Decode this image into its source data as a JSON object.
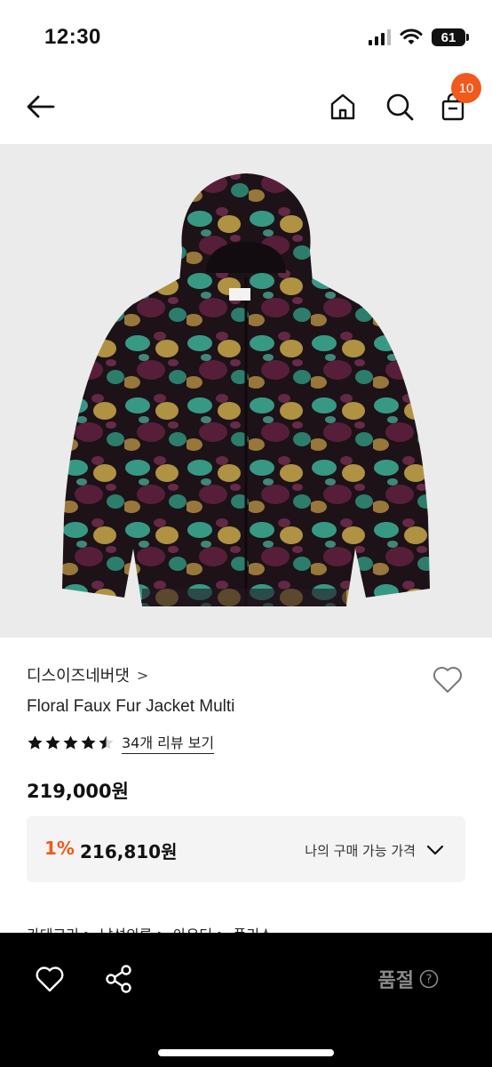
{
  "status_bar": {
    "time": "12:30",
    "battery": "61",
    "icons": [
      "cellular-signal-icon",
      "wifi-icon",
      "battery-icon"
    ]
  },
  "nav": {
    "icons": [
      "arrow-left-icon",
      "home-icon",
      "search-icon",
      "shopping-bag-icon"
    ],
    "cart_count": "10"
  },
  "product": {
    "brand": "디스이즈네버댓",
    "brand_chevron": ">",
    "name": "Floral Faux Fur Jacket Multi",
    "rating_stars": 4.5,
    "review_link": "34개 리뷰 보기",
    "price": "219,000원",
    "my_price": {
      "discount": "1%",
      "price": "216,810원",
      "label": "나의 구매 가능 가격"
    },
    "category": "카테고리 > 남성의류 > 아우터 > 플리스"
  },
  "bottom_bar": {
    "status_label": "품절",
    "icons": [
      "heart-icon",
      "share-icon",
      "help-circle-icon"
    ]
  },
  "colors": {
    "accent": "#f2591c",
    "image_bg": "#ebebeb",
    "price_box_bg": "#f4f4f4",
    "bottom_bar_bg": "#000000"
  }
}
